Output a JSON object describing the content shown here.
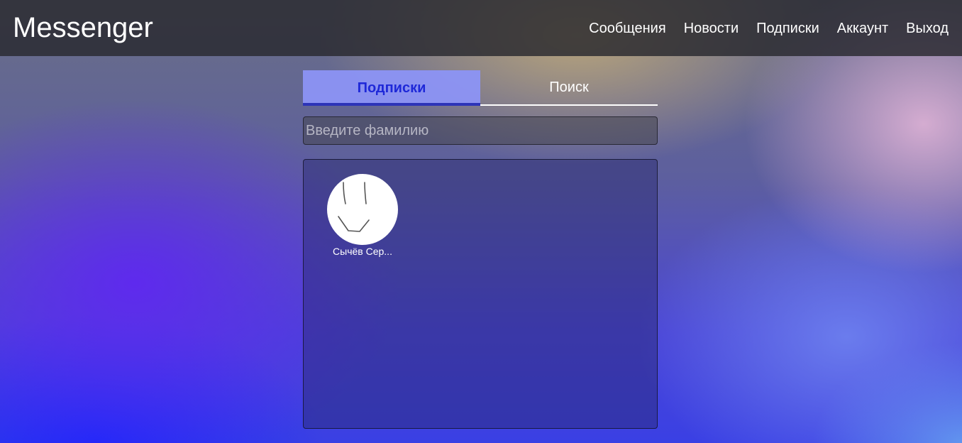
{
  "app": {
    "title": "Messenger"
  },
  "nav": {
    "items": [
      {
        "label": "Сообщения"
      },
      {
        "label": "Новости"
      },
      {
        "label": "Подписки"
      },
      {
        "label": "Аккаунт"
      },
      {
        "label": "Выход"
      }
    ]
  },
  "tabs": [
    {
      "label": "Подписки",
      "active": true
    },
    {
      "label": "Поиск",
      "active": false
    }
  ],
  "search": {
    "placeholder": "Введите фамилию",
    "value": ""
  },
  "subscriptions": [
    {
      "name": "Сычёв Сер...",
      "avatar_icon": "smiley-drawing-icon"
    }
  ],
  "colors": {
    "tab_active_bg": "#8c94f5",
    "tab_active_text": "#1e28d8",
    "navbar_bg": "#28282e"
  }
}
